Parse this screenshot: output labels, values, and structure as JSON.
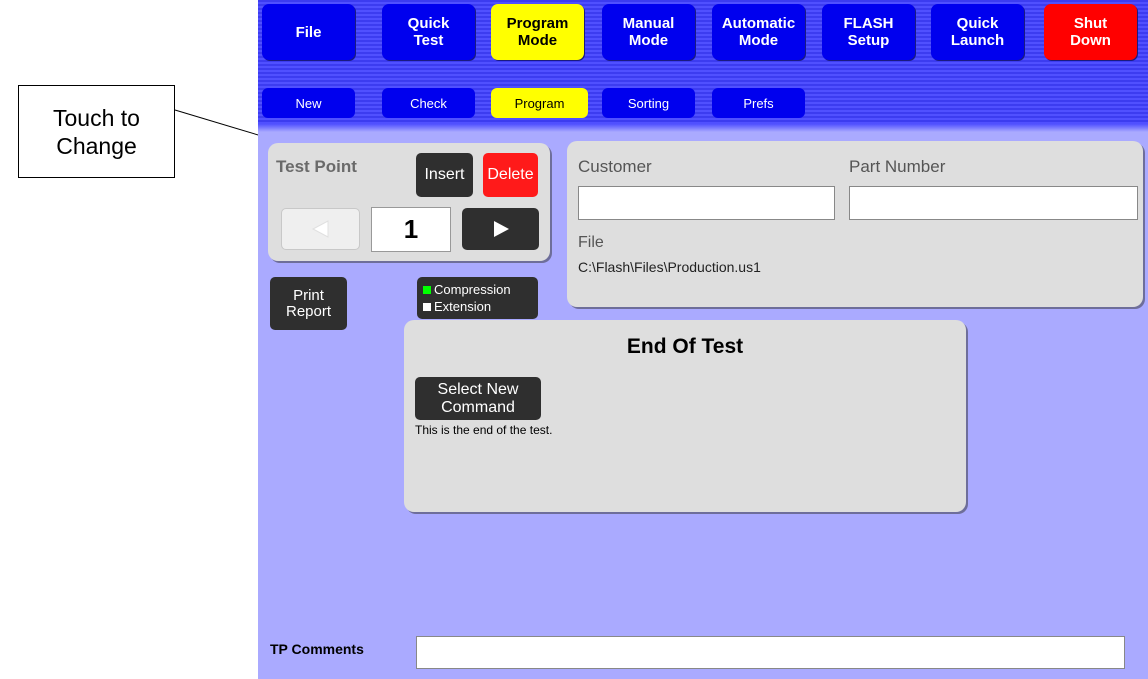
{
  "callout": {
    "text": "Touch to\nChange"
  },
  "menu": {
    "main": [
      {
        "label": "File"
      },
      {
        "label": "Quick\nTest"
      },
      {
        "label": "Program\nMode"
      },
      {
        "label": "Manual\nMode"
      },
      {
        "label": "Automatic\nMode"
      },
      {
        "label": "FLASH\nSetup"
      },
      {
        "label": "Quick\nLaunch"
      },
      {
        "label": "Shut\nDown"
      }
    ],
    "sub": [
      {
        "label": "New"
      },
      {
        "label": "Check"
      },
      {
        "label": "Program"
      },
      {
        "label": "Sorting"
      },
      {
        "label": "Prefs"
      }
    ]
  },
  "test_point": {
    "label": "Test Point",
    "insert_label": "Insert",
    "delete_label": "Delete",
    "value": "1",
    "prev_icon": "left-arrow-icon",
    "next_icon": "right-arrow-icon"
  },
  "print_report_label": "Print\nReport",
  "mode_toggle": {
    "compression_label": "Compression",
    "extension_label": "Extension",
    "compression_color": "#00ff00",
    "extension_color": "#ffffff"
  },
  "info": {
    "customer_label": "Customer",
    "customer_value": "",
    "part_number_label": "Part Number",
    "part_number_value": "",
    "file_label": "File",
    "file_path": "C:\\Flash\\Files\\Production.us1"
  },
  "command": {
    "title": "End Of Test",
    "select_button_label": "Select New\nCommand",
    "description": "This is the end of the test."
  },
  "comments": {
    "label": "TP Comments",
    "value": ""
  },
  "colors": {
    "background": "#aaaaff",
    "menu_blue": "#0000ee",
    "active_yellow": "#ffff00",
    "danger_red": "#ff0000"
  }
}
